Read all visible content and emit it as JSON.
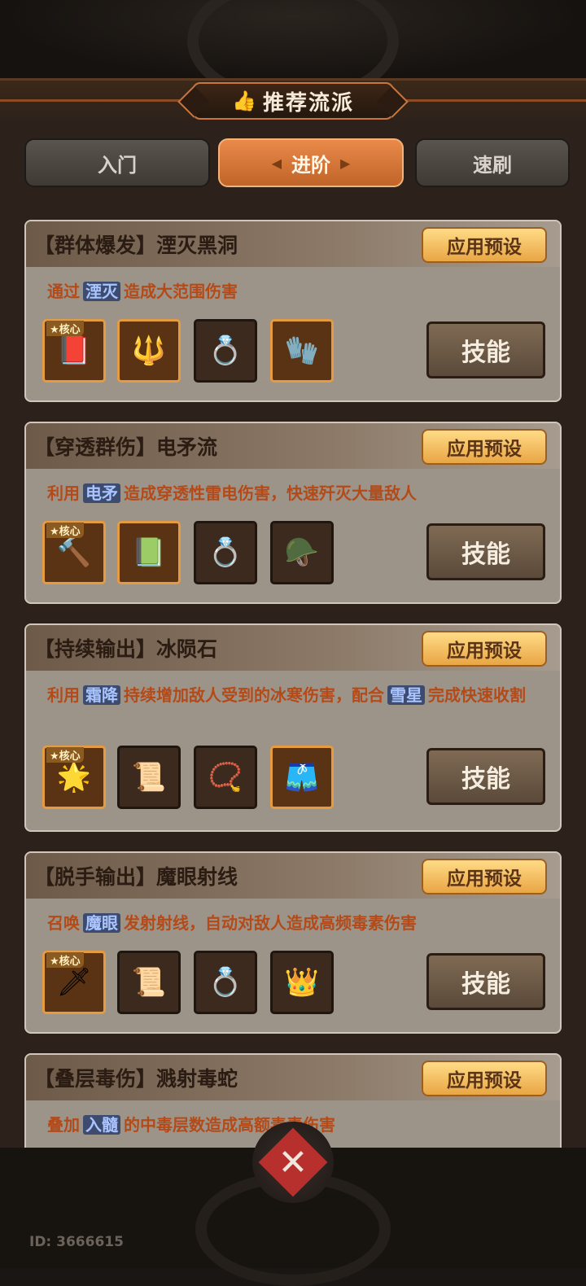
{
  "header": {
    "title": "推荐流派",
    "title_icon": "👍"
  },
  "tabs": [
    {
      "label": "入门",
      "active": false
    },
    {
      "label": "进阶",
      "active": true
    },
    {
      "label": "速刷",
      "active": false
    }
  ],
  "card_common": {
    "apply_label": "应用预设",
    "skill_label": "技能",
    "core_label": "★核心"
  },
  "cards": [
    {
      "title": "【群体爆发】湮灭黑洞",
      "desc_before": "通过",
      "keyword1": "湮灭",
      "desc_mid": "造成大范围伤害",
      "keyword2": "",
      "desc_after": "",
      "items": [
        "📕",
        "🔱",
        "💍",
        "🧤"
      ]
    },
    {
      "title": "【穿透群伤】电矛流",
      "desc_before": "利用",
      "keyword1": "电矛",
      "desc_mid": "造成穿透性雷电伤害，快速歼灭大量敌人",
      "keyword2": "",
      "desc_after": "",
      "items": [
        "🔨",
        "📗",
        "💍",
        "🪖"
      ]
    },
    {
      "title": "【持续输出】冰陨石",
      "desc_before": "利用",
      "keyword1": "霜降",
      "desc_mid": "持续增加敌人受到的冰寒伤害，配合",
      "keyword2": "雪星",
      "desc_after": "完成快速收割",
      "items": [
        "🌟",
        "📜",
        "📿",
        "🩳"
      ]
    },
    {
      "title": "【脱手输出】魔眼射线",
      "desc_before": "召唤",
      "keyword1": "魔眼",
      "desc_mid": "发射射线，自动对敌人造成高频毒素伤害",
      "keyword2": "",
      "desc_after": "",
      "items": [
        "🗡",
        "📜",
        "💍",
        "👑"
      ]
    },
    {
      "title": "【叠层毒伤】溅射毒蛇",
      "desc_before": "叠加",
      "keyword1": "入髓",
      "desc_mid": "的中毒层数造成高额毒素伤害",
      "keyword2": "",
      "desc_after": "",
      "items": [
        "🗡",
        "📜",
        "💍",
        "👑"
      ]
    }
  ],
  "footer": {
    "id_text": "ID: 3666615"
  },
  "colors": {
    "accent": "#d9773a",
    "keyword_bg": "#3c4b6e",
    "apply_btn": "#f2bf62"
  }
}
